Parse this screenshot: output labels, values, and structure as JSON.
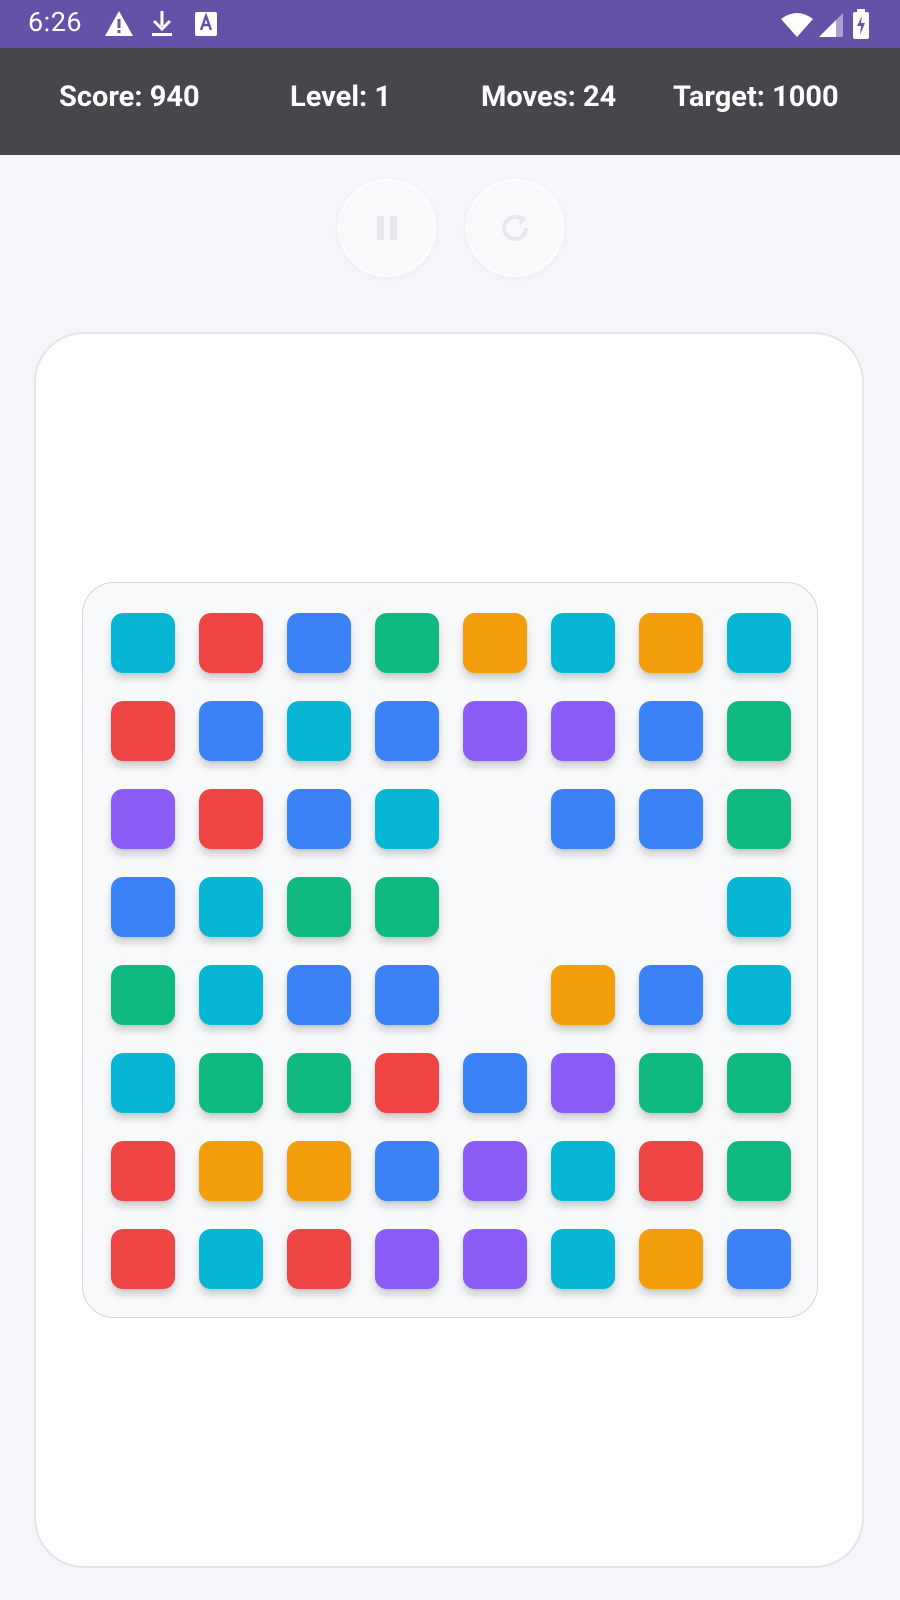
{
  "status_bar": {
    "time": "6:26",
    "left_icons": [
      "alert-triangle-icon",
      "download-icon",
      "font-app-icon"
    ],
    "right_icons": [
      "wifi-icon",
      "signal-icon",
      "battery-charging-icon"
    ]
  },
  "header": {
    "score_text": "Score: 940",
    "level_text": "Level: 1",
    "moves_text": "Moves: 24",
    "target_text": "Target: 1000"
  },
  "controls": {
    "pause_icon": "pause-icon",
    "restart_icon": "restart-icon"
  },
  "colors": {
    "status_bar": "#6552a8",
    "header": "#47474b",
    "cyan": "#06b6d4",
    "red": "#ef4444",
    "blue": "#3b82f6",
    "green": "#10b981",
    "orange": "#f59e0b",
    "purple": "#8b5cf6"
  },
  "board": {
    "rows": 8,
    "cols": 8,
    "grid": [
      [
        "cyan",
        "red",
        "blue",
        "green",
        "orange",
        "cyan",
        "orange",
        "cyan"
      ],
      [
        "red",
        "blue",
        "cyan",
        "blue",
        "purple",
        "purple",
        "blue",
        "green"
      ],
      [
        "purple",
        "red",
        "blue",
        "cyan",
        null,
        "blue",
        "blue",
        "green"
      ],
      [
        "blue",
        "cyan",
        "green",
        "green",
        null,
        null,
        null,
        "cyan"
      ],
      [
        "green",
        "cyan",
        "blue",
        "blue",
        null,
        "orange",
        "blue",
        "cyan"
      ],
      [
        "cyan",
        "green",
        "green",
        "red",
        "blue",
        "purple",
        "green",
        "green"
      ],
      [
        "red",
        "orange",
        "orange",
        "blue",
        "purple",
        "cyan",
        "red",
        "green"
      ],
      [
        "red",
        "cyan",
        "red",
        "purple",
        "purple",
        "cyan",
        "orange",
        "blue"
      ]
    ]
  }
}
